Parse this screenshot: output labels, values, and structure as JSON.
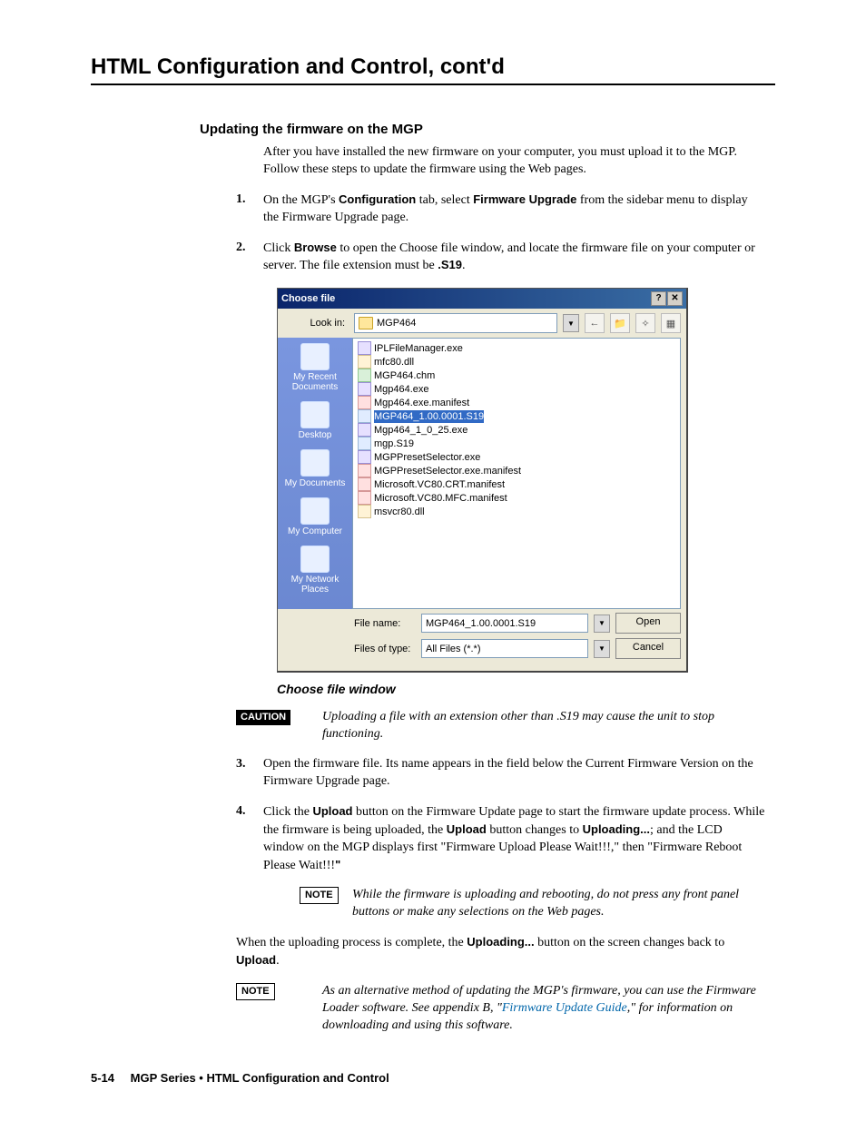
{
  "header": {
    "section_title": "HTML Configuration and Control, cont'd",
    "subsection_title": "Updating the firmware on the MGP"
  },
  "intro": "After you have installed the new firmware on your computer, you must upload it to the MGP.  Follow these steps to update the firmware using the Web pages.",
  "steps": {
    "s1": {
      "num": "1",
      "a": "On the MGP's ",
      "b": "Configuration",
      "c": " tab, select ",
      "d": "Firmware Upgrade",
      "e": " from the sidebar menu to display the Firmware Upgrade page."
    },
    "s2": {
      "num": "2",
      "a": "Click ",
      "b": "Browse",
      "c": " to open the Choose file window, and locate the firmware file on your computer or server.  The file extension must be ",
      "d": ".S19",
      "e": "."
    },
    "s3": {
      "num": "3",
      "text": "Open the firmware file.  Its name appears in the field below the Current Firmware Version on the Firmware Upgrade page."
    },
    "s4": {
      "num": "4",
      "a": "Click the ",
      "b": "Upload",
      "c": " button on the Firmware Update page to start the firmware update process.  While the firmware is being uploaded, the ",
      "d": "Upload",
      "e": " button changes to ",
      "f": "Uploading...",
      "g": "; and the LCD window on the MGP displays first \"Firmware Upload Please Wait!!!,\" then \"Firmware Reboot Please Wait!!!",
      "h": "\""
    }
  },
  "figure_caption": "Choose file window",
  "caution": {
    "label": "CAUTION",
    "text": "Uploading a file with an extension other than .S19 may cause the unit to stop functioning."
  },
  "note_inner": {
    "label": "NOTE",
    "text": "While the firmware is uploading and rebooting, do not press any front panel buttons or make any selections on the Web pages."
  },
  "closing": {
    "a": "When the uploading process is complete, the ",
    "b": "Uploading...",
    "c": " button on the screen changes back to ",
    "d": "Upload",
    "e": "."
  },
  "note_alt": {
    "label": "NOTE",
    "a": "As an alternative method of updating the MGP's firmware, you can use the Firmware Loader software.  See appendix B, \"",
    "link": "Firmware Update Guide",
    "b": ",\" for information on downloading and using this software."
  },
  "footer": {
    "page": "5-14",
    "text": "MGP Series • HTML Configuration and Control"
  },
  "dialog": {
    "title": "Choose file",
    "lookin_label": "Look in:",
    "lookin_value": "MGP464",
    "sidebar": {
      "recent": "My Recent Documents",
      "desktop": "Desktop",
      "docs": "My Documents",
      "computer": "My Computer",
      "network": "My Network Places"
    },
    "files": [
      "IPLFileManager.exe",
      "mfc80.dll",
      "MGP464.chm",
      "Mgp464.exe",
      "Mgp464.exe.manifest",
      "MGP464_1.00.0001.S19",
      "Mgp464_1_0_25.exe",
      "mgp.S19",
      "MGPPresetSelector.exe",
      "MGPPresetSelector.exe.manifest",
      "Microsoft.VC80.CRT.manifest",
      "Microsoft.VC80.MFC.manifest",
      "msvcr80.dll"
    ],
    "filename_label": "File name:",
    "filename_value": "MGP464_1.00.0001.S19",
    "filetype_label": "Files of type:",
    "filetype_value": "All Files (*.*)",
    "open": "Open",
    "cancel": "Cancel"
  }
}
